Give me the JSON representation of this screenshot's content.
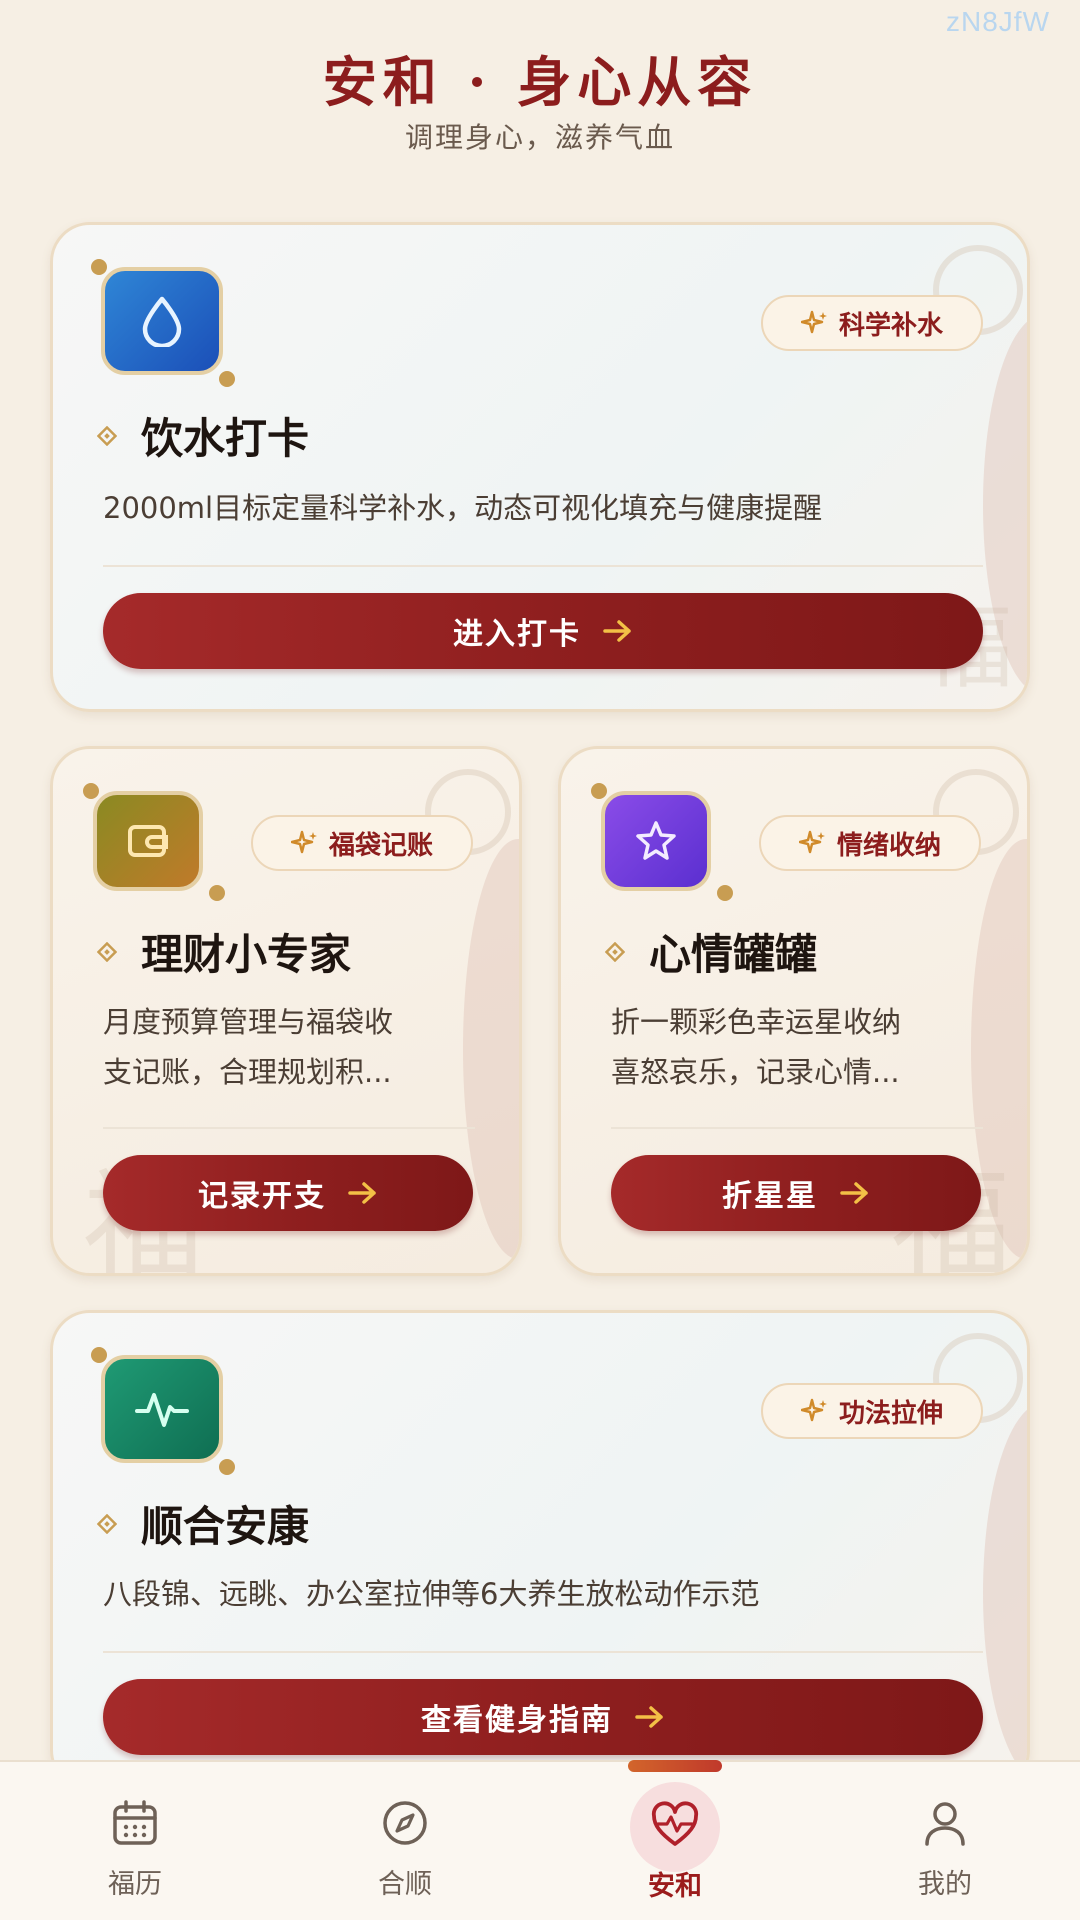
{
  "watermark": "zN8JfW",
  "header": {
    "title": "安和 · 身心从容",
    "subtitle": "调理身心，滋养气血"
  },
  "cards": {
    "water": {
      "badge": "科学补水",
      "title": "饮水打卡",
      "desc": "2000ml目标定量科学补水，动态可视化填充与健康提醒",
      "button": "进入打卡",
      "icon": "water-drop-icon"
    },
    "finance": {
      "badge": "福袋记账",
      "title": "理财小专家",
      "desc_line1": "月度预算管理与福袋收",
      "desc_line2": "支记账，合理规划积...",
      "button": "记录开支",
      "icon": "wallet-icon"
    },
    "mood": {
      "badge": "情绪收纳",
      "title": "心情罐罐",
      "desc_line1": "折一颗彩色幸运星收纳",
      "desc_line2": "喜怒哀乐，记录心情...",
      "button": "折星星",
      "icon": "star-icon"
    },
    "exercise": {
      "badge": "功法拉伸",
      "title": "顺合安康",
      "desc": "八段锦、远眺、办公室拉伸等6大养生放松动作示范",
      "button": "查看健身指南",
      "icon": "pulse-icon"
    }
  },
  "nav": {
    "items": [
      {
        "label": "福历",
        "icon": "calendar-icon"
      },
      {
        "label": "合顺",
        "icon": "compass-icon"
      },
      {
        "label": "安和",
        "icon": "heart-pulse-icon",
        "active": true
      },
      {
        "label": "我的",
        "icon": "user-icon"
      }
    ]
  },
  "colors": {
    "primary": "#8c1d1d",
    "background": "#f6efe4",
    "gold": "#c89d52"
  }
}
